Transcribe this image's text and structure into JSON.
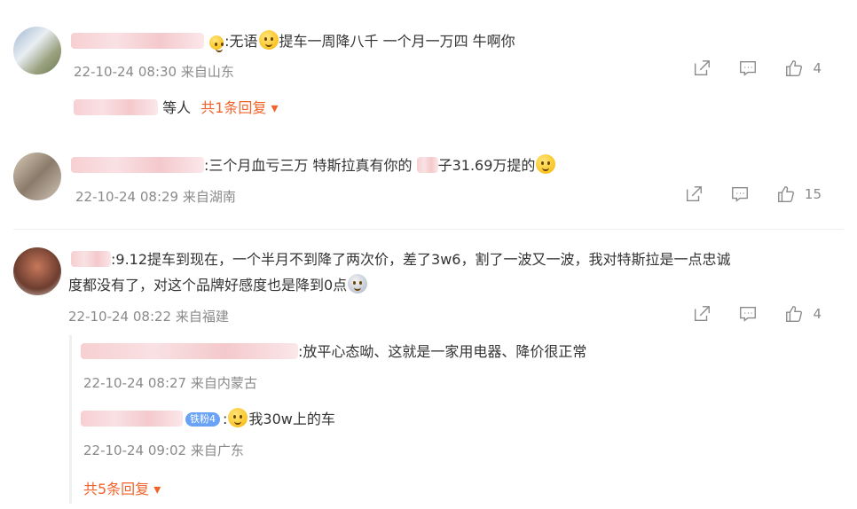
{
  "comments": [
    {
      "text_prefix": ":无语",
      "text_suffix": "提车一周降八千 一个月一万四 牛啊你",
      "meta": "22-10-24 08:30 来自山东",
      "likes": "4",
      "replies_summary_suffix": "等人",
      "replies_link": "共1条回复 ▾"
    },
    {
      "text_prefix": ":三个月血亏三万 特斯拉真有你的",
      "text_mid": "子31.69万提的",
      "meta": "22-10-24 08:29 来自湖南",
      "likes": "15"
    },
    {
      "line1": ":9.12提车到现在，一个半月不到降了两次价，差了3w6，割了一波又一波，我对特斯拉是一点忠诚",
      "line2": "度都没有了，对这个品牌好感度也是降到0点",
      "meta": "22-10-24 08:22 来自福建",
      "likes": "4",
      "replies": [
        {
          "text": ":放平心态呦、这就是一家用电器、降价很正常",
          "meta": "22-10-24 08:27 来自内蒙古"
        },
        {
          "badge": "铁粉4",
          "text": "我30w上的车",
          "meta": "22-10-24 09:02 来自广东"
        }
      ],
      "replies_link": "共5条回复 ▾"
    }
  ],
  "icons": [
    "share-icon",
    "comment-icon",
    "like-icon"
  ],
  "colors": {
    "accent": "#f0642c",
    "meta": "#8a8a8a",
    "text": "#333333"
  }
}
